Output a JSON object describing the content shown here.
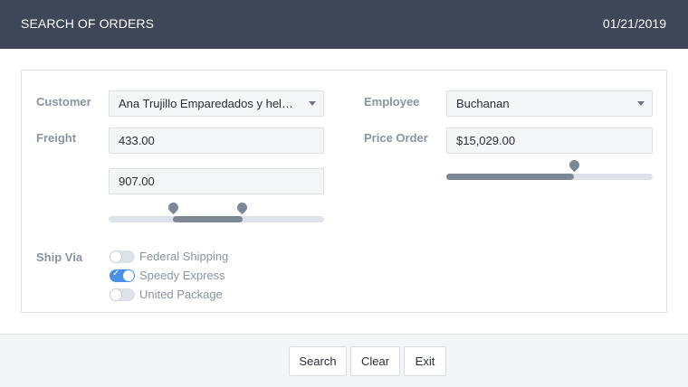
{
  "header": {
    "title": "SEARCH OF ORDERS",
    "date": "01/21/2019"
  },
  "form": {
    "customer": {
      "label": "Customer",
      "value": "Ana Trujillo Emparedados y hela…"
    },
    "employee": {
      "label": "Employee",
      "value": "Buchanan"
    },
    "freight": {
      "label": "Freight",
      "min_value": "433.00",
      "max_value": "907.00",
      "range_low_fraction": 0.3,
      "range_high_fraction": 0.62
    },
    "price_order": {
      "label": "Price Order",
      "value": "$15,029.00",
      "fraction": 0.62
    },
    "ship_via": {
      "label": "Ship Via",
      "options": [
        {
          "label": "Federal Shipping",
          "checked": false
        },
        {
          "label": "Speedy Express",
          "checked": true
        },
        {
          "label": "United Package",
          "checked": false
        }
      ]
    }
  },
  "footer": {
    "search_label": "Search",
    "clear_label": "Clear",
    "exit_label": "Exit"
  }
}
